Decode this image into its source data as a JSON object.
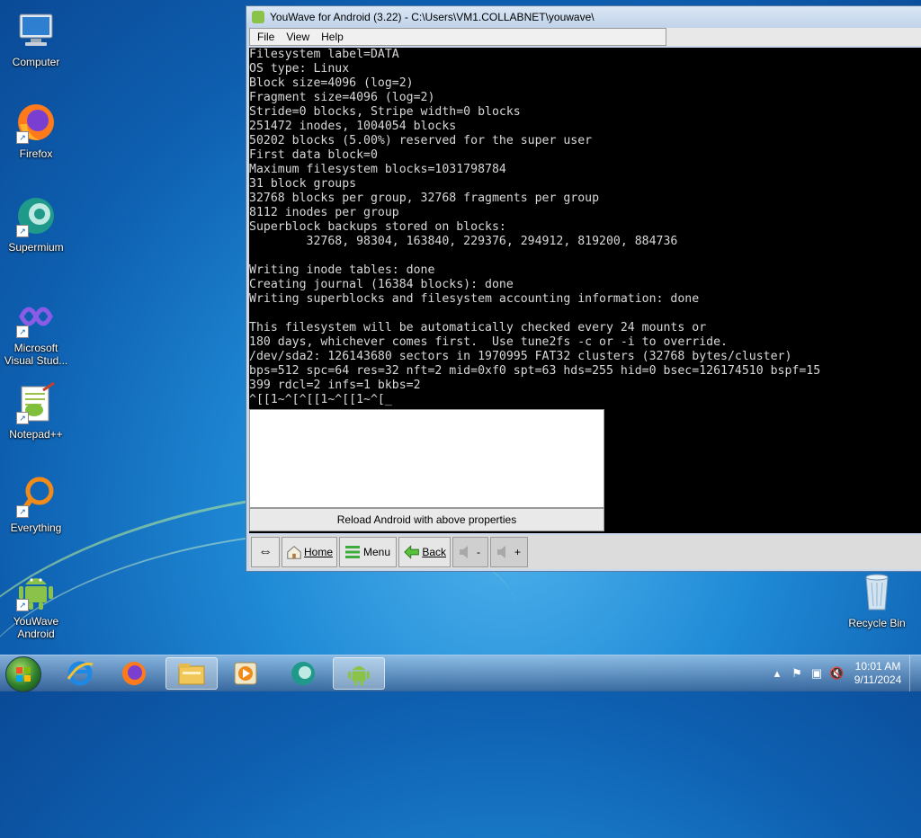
{
  "desktop": {
    "icons": [
      {
        "label_line1": "Computer",
        "label_line2": ""
      },
      {
        "label_line1": "Firefox",
        "label_line2": ""
      },
      {
        "label_line1": "Supermium",
        "label_line2": ""
      },
      {
        "label_line1": "Microsoft",
        "label_line2": "Visual Stud..."
      },
      {
        "label_line1": "Notepad++",
        "label_line2": ""
      },
      {
        "label_line1": "Everything",
        "label_line2": ""
      },
      {
        "label_line1": "YouWave",
        "label_line2": "Android"
      },
      {
        "label_line1": "Recycle Bin",
        "label_line2": ""
      }
    ]
  },
  "window": {
    "title": "YouWave for Android (3.22) - C:\\Users\\VM1.COLLABNET\\youwave\\",
    "menu": [
      {
        "label": "File"
      },
      {
        "label": "View"
      },
      {
        "label": "Help"
      }
    ],
    "console_text": "Filesystem label=DATA\nOS type: Linux\nBlock size=4096 (log=2)\nFragment size=4096 (log=2)\nStride=0 blocks, Stripe width=0 blocks\n251472 inodes, 1004054 blocks\n50202 blocks (5.00%) reserved for the super user\nFirst data block=0\nMaximum filesystem blocks=1031798784\n31 block groups\n32768 blocks per group, 32768 fragments per group\n8112 inodes per group\nSuperblock backups stored on blocks:\n        32768, 98304, 163840, 229376, 294912, 819200, 884736\n\nWriting inode tables: done\nCreating journal (16384 blocks): done\nWriting superblocks and filesystem accounting information: done\n\nThis filesystem will be automatically checked every 24 mounts or\n180 days, whichever comes first.  Use tune2fs -c or -i to override.\n/dev/sda2: 126143680 sectors in 1970995 FAT32 clusters (32768 bytes/cluster)\nbps=512 spc=64 res=32 nft=2 mid=0xf0 spt=63 hds=255 hid=0 bsec=126174510 bspf=15\n399 rdcl=2 infs=1 bkbs=2\n^[[1~^[^[[1~^[[1~^[_",
    "reload_label": "Reload Android with above properties",
    "toolbar": {
      "home": "Home",
      "menu": "Menu",
      "back": "Back",
      "vol_down": "-",
      "vol_up": "+"
    }
  },
  "taskbar": {
    "time": "10:01 AM",
    "date": "9/11/2024",
    "items": [
      "internet-explorer-icon",
      "firefox-icon",
      "file-explorer-icon",
      "media-player-icon",
      "supermium-icon",
      "youwave-icon"
    ]
  },
  "colors": {
    "console_bg": "#000000",
    "console_text": "#d8d8d8",
    "desktop_bg": "#1f8ad6"
  }
}
